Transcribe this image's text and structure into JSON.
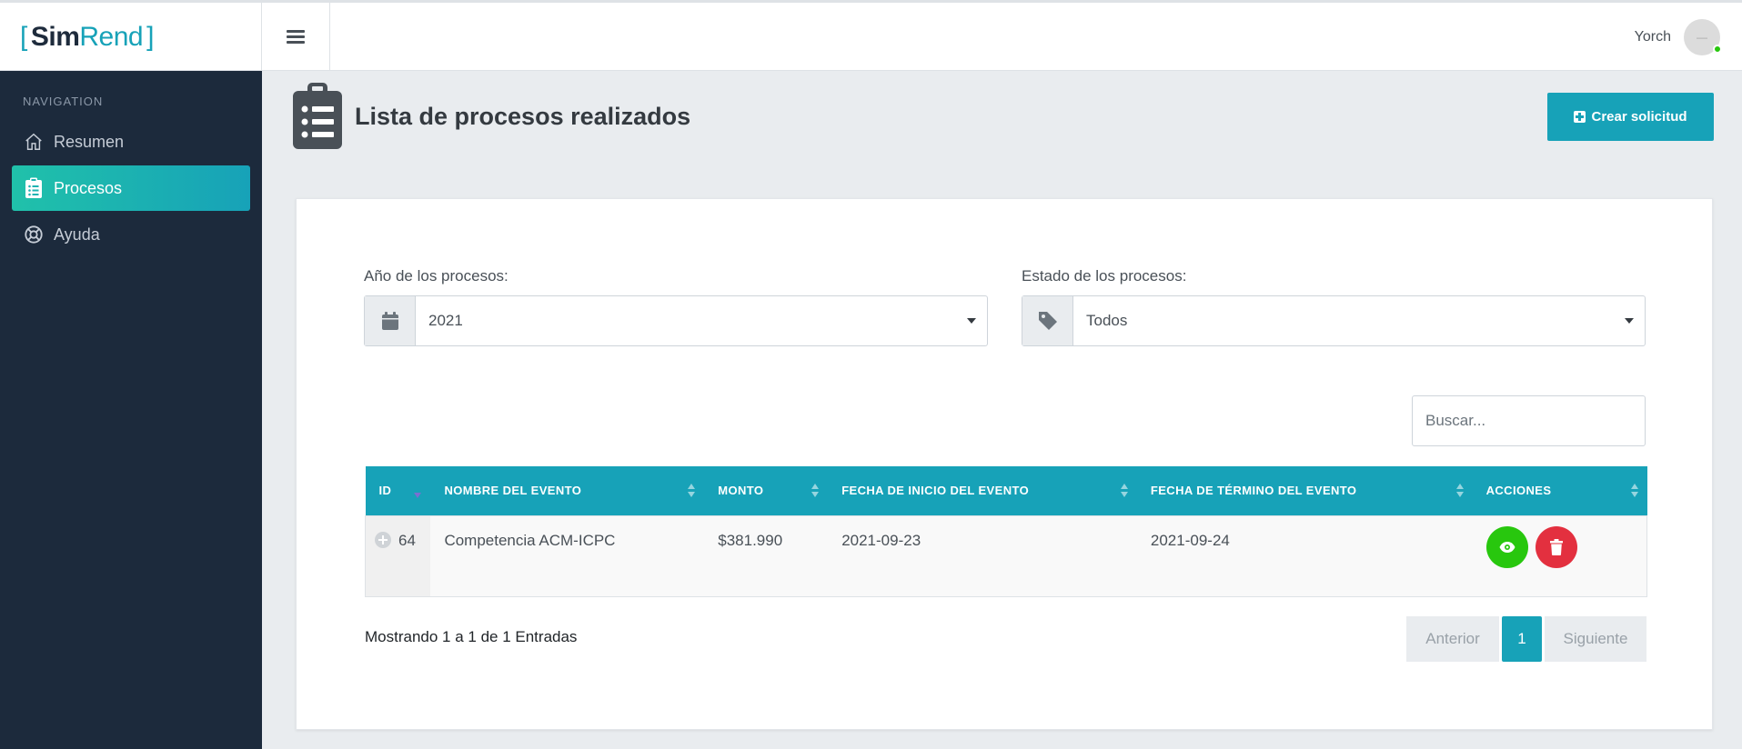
{
  "brand": {
    "open": "[",
    "sim": "Sim",
    "rend": "Rend",
    "close": "]"
  },
  "user": {
    "name": "Yorch",
    "avatar_text": "—",
    "status_color": "#28c70e"
  },
  "sidebar": {
    "heading": "NAVIGATION",
    "items": [
      {
        "label": "Resumen",
        "icon": "home-icon",
        "active": false
      },
      {
        "label": "Procesos",
        "icon": "clipboard-list-icon",
        "active": true
      },
      {
        "label": "Ayuda",
        "icon": "lifebuoy-icon",
        "active": false
      }
    ]
  },
  "page": {
    "title": "Lista de procesos realizados",
    "create_button": "Crear solicitud"
  },
  "filters": {
    "year": {
      "label": "Año de los procesos:",
      "value": "2021",
      "icon": "calendar-icon"
    },
    "status": {
      "label": "Estado de los procesos:",
      "value": "Todos",
      "icon": "tag-icon"
    }
  },
  "search": {
    "placeholder": "Buscar..."
  },
  "table": {
    "columns": [
      "ID",
      "NOMBRE DEL EVENTO",
      "MONTO",
      "FECHA DE INICIO DEL EVENTO",
      "FECHA DE TÉRMINO DEL EVENTO",
      "ACCIONES"
    ],
    "rows": [
      {
        "id": "64",
        "name": "Competencia ACM-ICPC",
        "amount": "$381.990",
        "start": "2021-09-23",
        "end": "2021-09-24"
      }
    ]
  },
  "pagination": {
    "info": "Mostrando 1 a 1 de 1 Entradas",
    "prev": "Anterior",
    "current": "1",
    "next": "Siguiente"
  },
  "colors": {
    "accent": "#17a2b8",
    "sidebar": "#1c2a3c",
    "view": "#28c70e",
    "delete": "#e3303f"
  }
}
